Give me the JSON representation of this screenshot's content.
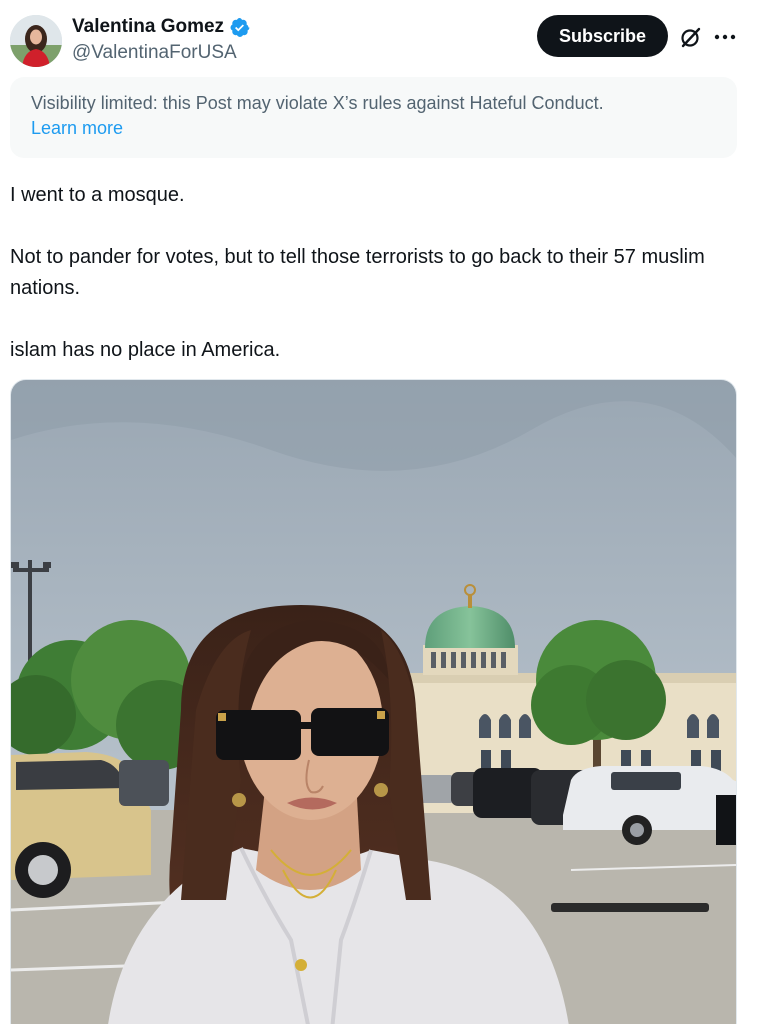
{
  "author": {
    "name": "Valentina Gomez",
    "handle": "@ValentinaForUSA",
    "verified": true
  },
  "actions": {
    "subscribe_label": "Subscribe",
    "grok_icon": "grok-icon",
    "more_icon": "more-dots-icon"
  },
  "notice": {
    "text": "Visibility limited: this Post may violate X’s rules against Hateful Conduct.",
    "link": "Learn more"
  },
  "post": {
    "paragraphs": [
      "I went to a mosque.",
      "Not to pander for votes, but to tell those terrorists to go back to their 57 muslim nations.",
      "islam has no place in America."
    ]
  },
  "colors": {
    "text_primary": "#0f1419",
    "text_secondary": "#536471",
    "link": "#1d9bf0",
    "button_bg": "#0f1419",
    "verified_badge": "#1d9bf0",
    "notice_bg": "#f7f9f9"
  }
}
